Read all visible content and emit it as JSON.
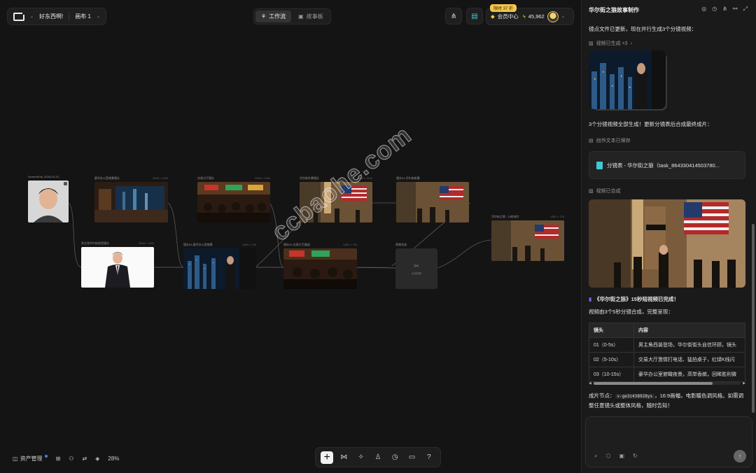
{
  "topbar": {
    "greeting": "好东西啊!",
    "canvas_name": "画布 1",
    "mode_workflow": "工作流",
    "mode_story": "故事板",
    "promo_badge": "限时 37 折",
    "member_center": "会员中心",
    "credits": "45,962"
  },
  "nodes": {
    "n1_label": "ScreenShot_2025-10-13...",
    "n2_label": "豪华办公室夜景镜头",
    "n2_size": "2048 × 1152",
    "n3_label": "交易大厅镜头",
    "n3_size": "2048 × 1152",
    "n4_label": "华尔街外景镜头",
    "n4_size": "2048 × 1152",
    "n5_label": "镜头01-华尔街街景",
    "n6_label": "男主角华尔街造型镜头",
    "n6_size": "2048 × 1152",
    "n7_label": "镜头03-豪华办公室夜景",
    "n7_size": "1280 × 720",
    "n8_label": "镜头02-交易大厅激战",
    "n8_size": "1280 × 720",
    "n9_label": "视频合成",
    "n9_sub": "合成视频",
    "n10_label": "华尔街之狼 - 15秒成片",
    "n10_size": "1280 × 720"
  },
  "watermark": "ccbaohe.com",
  "bottom_left": {
    "assets": "资产管理",
    "zoom": "28%"
  },
  "panel": {
    "title": "华尔街之狼故事制作",
    "msg1": "镜点文件已更新，现在并行生成3个分镜视频：",
    "video_generated": "视频已生成 ×3",
    "msg2": "3个分镜视频全部生成！更新分镜表后合成最终成片：",
    "doc_saved": "创作文本已保存",
    "file_name": "分镜表 - 华尔街之狼（task_864330414503780...",
    "video_merged": "视频已合成",
    "done_title": "《华尔街之狼》15秒短视频已完成！",
    "done_desc": "视频由3个5秒分镜合成，完整呈现：",
    "table": {
      "headers": [
        "镜头",
        "内容"
      ],
      "rows": [
        [
          "01（0-5s）",
          "男主角西装登场，华尔街街头自信环顾，镜头"
        ],
        [
          "02（5-10s）",
          "交易大厅激情打电话、猛拍桌子，红绿K线闪"
        ],
        [
          "03（10-15s）",
          "豪华办公室俯瞰夜景，高举香槟，回眸胜利微"
        ]
      ]
    },
    "final_prefix": "成片节点：",
    "node_code": "v-ge3z438928ys",
    "final_suffix": "，16:9画幅，电影暖色调风格。如需调整任意镜头或整体风格，随时告知！"
  },
  "colors": {
    "background": "#141414",
    "panel": "#1a1a1a",
    "accent_gold": "#f3c64c",
    "file_icon": "#3fc8d9"
  }
}
